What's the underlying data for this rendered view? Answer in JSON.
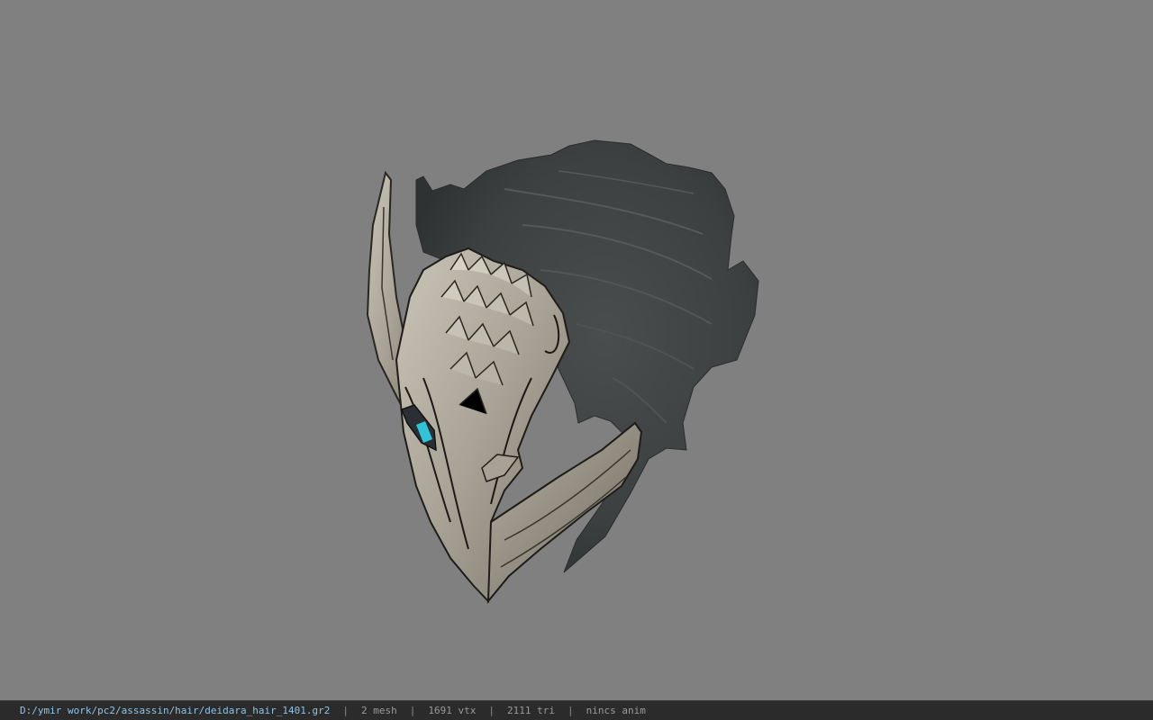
{
  "viewer": {
    "background_color": "#808080",
    "model_name_icon": "hair-helmet-3d-model"
  },
  "statusbar": {
    "file_path": "D:/ymir work/pc2/assassin/hair/deidara_hair_1401.gr2",
    "mesh": "2 mesh",
    "vtx": "1691 vtx",
    "tri": "2111 tri",
    "anim": "nincs anim",
    "separator": "|",
    "path_color": "#8ec3e8"
  }
}
